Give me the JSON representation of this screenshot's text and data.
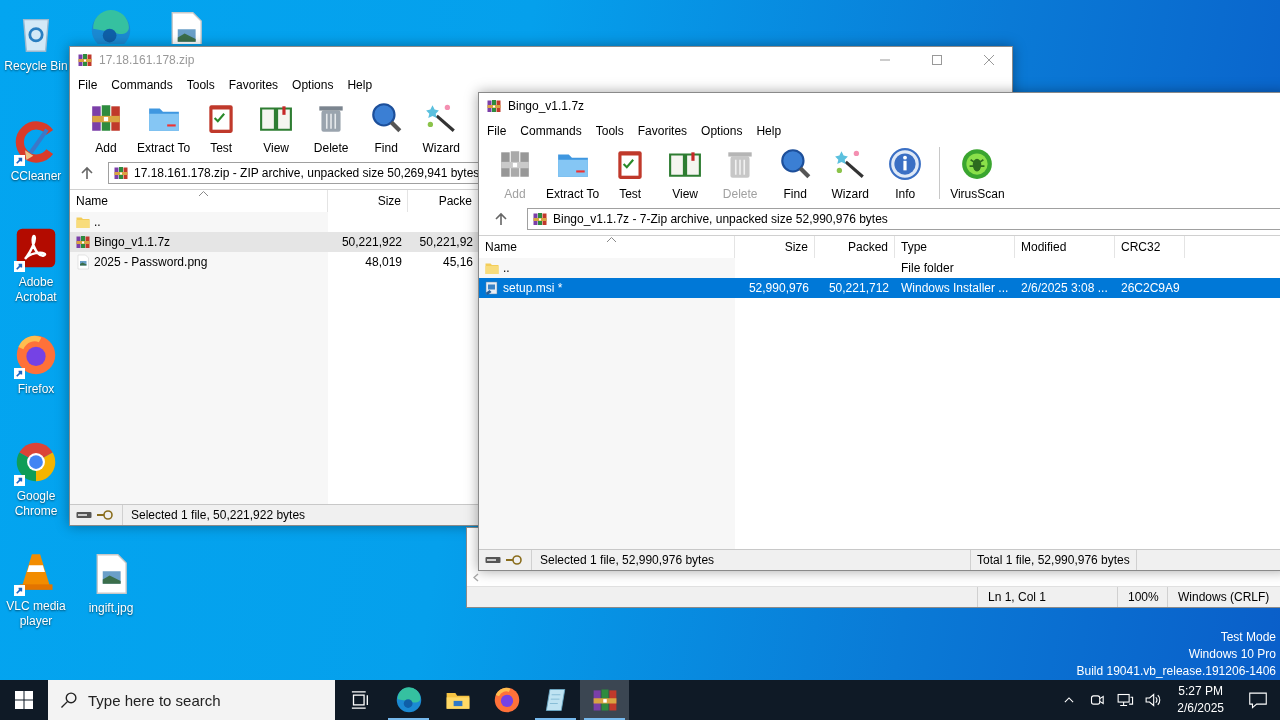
{
  "desktop_icons": [
    {
      "kind": "recycle",
      "label": "Recycle Bin",
      "shortcut": false
    },
    {
      "kind": "edge",
      "shortcut": false
    },
    {
      "kind": "imagefile",
      "shortcut": false
    },
    {
      "kind": "ccleaner",
      "label": "CCleaner",
      "shortcut": true
    },
    {
      "kind": "acrobat",
      "label": "Adobe Acrobat",
      "shortcut": true
    },
    {
      "kind": "firefox",
      "label": "Firefox",
      "shortcut": true
    },
    {
      "kind": "chrome",
      "label": "Google Chrome",
      "shortcut": true
    },
    {
      "kind": "vlc",
      "label": "VLC media player",
      "shortcut": true
    },
    {
      "kind": "imagefile",
      "label": "ingift.jpg",
      "shortcut": false
    }
  ],
  "windows": [
    {
      "title": "17.18.161.178.zip",
      "active": false,
      "caption_buttons": true,
      "menu": [
        "File",
        "Commands",
        "Tools",
        "Favorites",
        "Options",
        "Help"
      ],
      "toolbar": [
        {
          "kind": "add",
          "label": "Add",
          "disabled": false
        },
        {
          "kind": "extract",
          "label": "Extract To",
          "disabled": false
        },
        {
          "kind": "test",
          "label": "Test",
          "disabled": false
        },
        {
          "kind": "view",
          "label": "View",
          "disabled": false
        },
        {
          "kind": "delete",
          "label": "Delete",
          "disabled": false
        },
        {
          "kind": "find",
          "label": "Find",
          "disabled": false
        },
        {
          "kind": "wizard",
          "label": "Wizard",
          "disabled": false
        }
      ],
      "address": "17.18.161.178.zip - ZIP archive, unpacked size 50,269,941 bytes",
      "columns": [
        "Name",
        "Size",
        "Packe"
      ],
      "rows": [
        {
          "kind": "folder",
          "name": "..",
          "selected": false
        },
        {
          "kind": "archive",
          "name": "Bingo_v1.1.7z",
          "size": "50,221,922",
          "packed": "50,221,92",
          "selected": true
        },
        {
          "kind": "image",
          "name": "2025 - Password.png",
          "size": "48,019",
          "packed": "45,16",
          "selected": false
        }
      ],
      "status": [
        "Selected 1 file, 50,221,922 bytes"
      ]
    },
    {
      "title": "Bingo_v1.1.7z",
      "active": true,
      "caption_buttons": false,
      "menu": [
        "File",
        "Commands",
        "Tools",
        "Favorites",
        "Options",
        "Help"
      ],
      "toolbar": [
        {
          "kind": "add",
          "label": "Add",
          "disabled": true
        },
        {
          "kind": "extract",
          "label": "Extract To",
          "disabled": false
        },
        {
          "kind": "test",
          "label": "Test",
          "disabled": false
        },
        {
          "kind": "view",
          "label": "View",
          "disabled": false
        },
        {
          "kind": "delete",
          "label": "Delete",
          "disabled": true
        },
        {
          "kind": "find",
          "label": "Find",
          "disabled": false
        },
        {
          "kind": "wizard",
          "label": "Wizard",
          "disabled": false
        },
        {
          "kind": "info",
          "label": "Info",
          "disabled": false
        },
        {
          "kind": "separator"
        },
        {
          "kind": "virus",
          "label": "VirusScan",
          "disabled": false
        }
      ],
      "address": "Bingo_v1.1.7z - 7-Zip archive, unpacked size 52,990,976 bytes",
      "columns": [
        "Name",
        "Size",
        "Packed",
        "Type",
        "Modified",
        "CRC32"
      ],
      "rows": [
        {
          "kind": "folder",
          "name": "..",
          "type": "File folder",
          "selected": false
        },
        {
          "kind": "installer",
          "name": "setup.msi *",
          "size": "52,990,976",
          "packed": "50,221,712",
          "type": "Windows Installer ...",
          "modified": "2/6/2025 3:08 ...",
          "crc32": "26C2C9A9",
          "selected": true
        }
      ],
      "status": [
        "Selected 1 file, 52,990,976 bytes",
        "Total 1 file, 52,990,976 bytes"
      ]
    }
  ],
  "notepad": {
    "status": [
      "Ln 1, Col 1",
      "100%",
      "Windows (CRLF)"
    ]
  },
  "system_info": [
    "Test Mode",
    "Windows 10 Pro",
    "Build 19041.vb_release.191206-1406"
  ],
  "taskbar": {
    "search": {
      "placeholder": "Type here to search"
    },
    "apps": [
      {
        "kind": "taskview",
        "running": false,
        "selected": false
      },
      {
        "kind": "edge",
        "running": true,
        "selected": false
      },
      {
        "kind": "explorer",
        "running": false,
        "selected": false
      },
      {
        "kind": "firefox",
        "running": false,
        "selected": false
      },
      {
        "kind": "notepad",
        "running": true,
        "selected": false
      },
      {
        "kind": "winrar",
        "running": true,
        "selected": true
      }
    ],
    "tray": [
      {
        "kind": "chevron"
      },
      {
        "kind": "meet"
      },
      {
        "kind": "network"
      },
      {
        "kind": "volume"
      }
    ],
    "clock": {
      "time": "5:27 PM",
      "date": "2/6/2025"
    }
  }
}
